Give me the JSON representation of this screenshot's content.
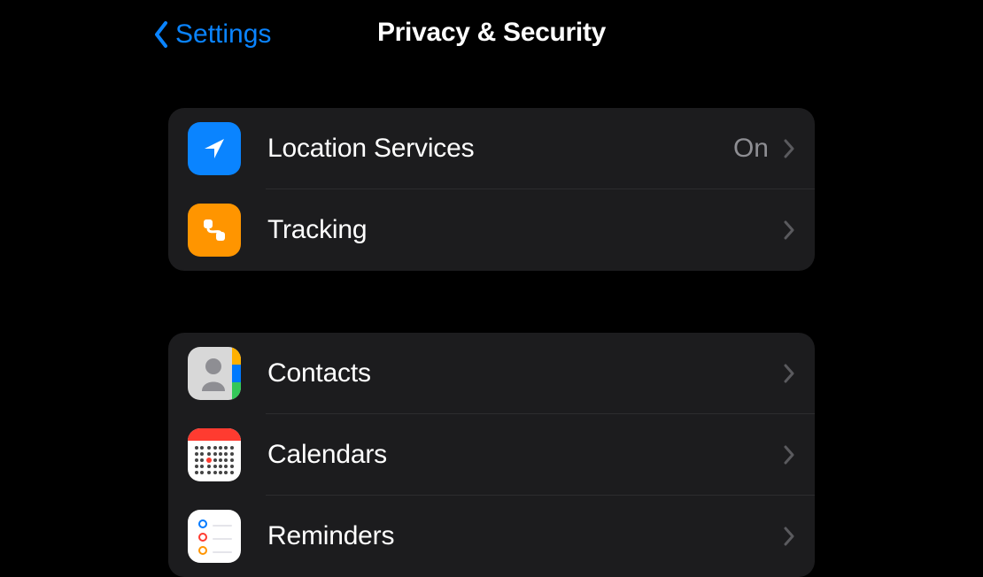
{
  "header": {
    "back_label": "Settings",
    "title": "Privacy & Security"
  },
  "groups": [
    {
      "rows": [
        {
          "label": "Location Services",
          "value": "On",
          "icon": "location"
        },
        {
          "label": "Tracking",
          "value": "",
          "icon": "tracking"
        }
      ]
    },
    {
      "rows": [
        {
          "label": "Contacts",
          "value": "",
          "icon": "contacts"
        },
        {
          "label": "Calendars",
          "value": "",
          "icon": "calendars"
        },
        {
          "label": "Reminders",
          "value": "",
          "icon": "reminders"
        }
      ]
    }
  ]
}
